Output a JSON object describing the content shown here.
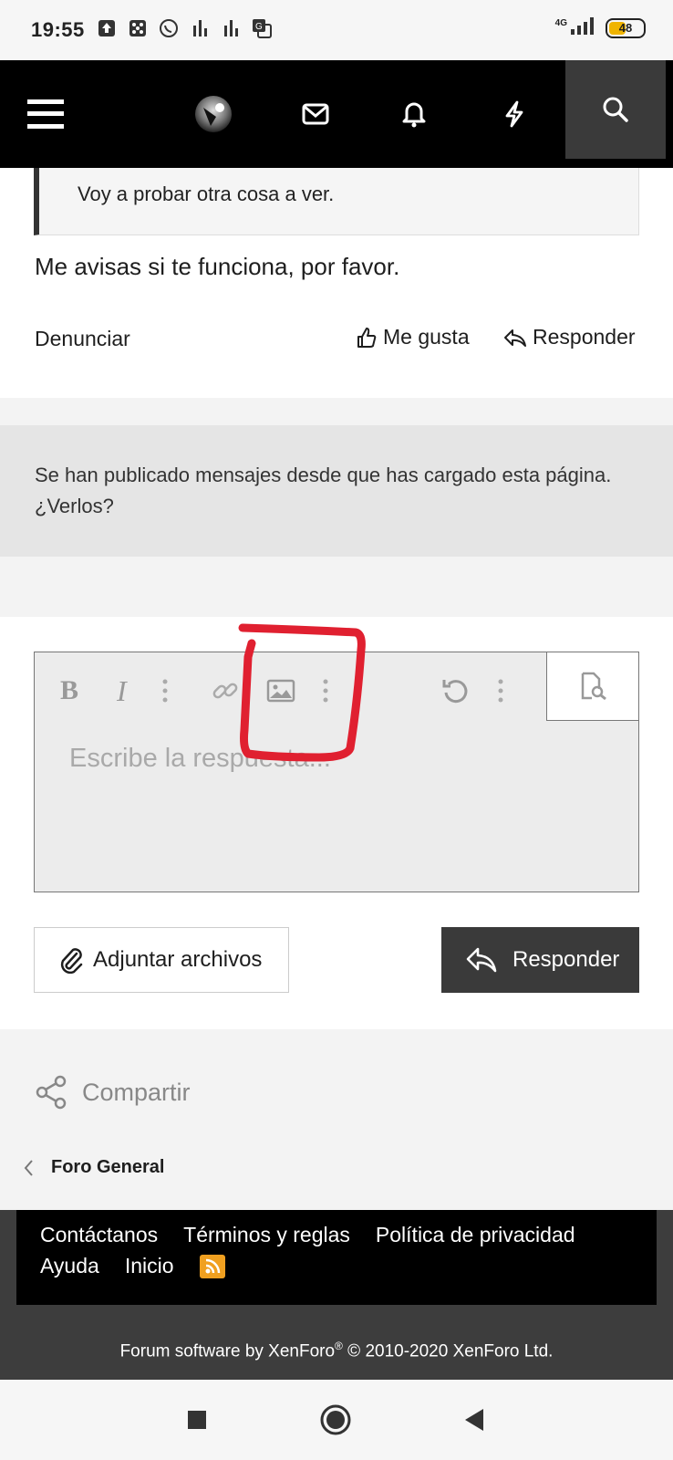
{
  "status_bar": {
    "time": "19:55",
    "network": "4G",
    "battery": "48"
  },
  "app_bar": {
    "icons": [
      "menu-icon",
      "avatar",
      "mail-icon",
      "bell-icon",
      "bolt-icon",
      "search-icon"
    ]
  },
  "post": {
    "quote_text": "Voy a probar otra cosa a ver.",
    "body_text": "Me avisas si te funciona, por favor.",
    "report_label": "Denunciar",
    "like_label": "Me gusta",
    "reply_label": "Responder"
  },
  "notice": {
    "text": "Se han publicado mensajes desde que has cargado esta página. ¿Verlos?"
  },
  "editor": {
    "bold_label": "B",
    "italic_label": "I",
    "placeholder": "Escribe la respuesta..."
  },
  "buttons": {
    "attach_label": "Adjuntar archivos",
    "submit_label": "Responder"
  },
  "share": {
    "label": "Compartir"
  },
  "breadcrumb": {
    "label": "Foro General"
  },
  "footer": {
    "links_row1": [
      "Contáctanos",
      "Términos y reglas",
      "Política de privacidad"
    ],
    "links_row2": [
      "Ayuda",
      "Inicio"
    ],
    "copyright_prefix": "Forum software by XenForo",
    "registered": "®",
    "copyright_suffix": " © 2010-2020 XenForo Ltd."
  },
  "colors": {
    "app_bar": "#000000",
    "search_button": "#3a3a3a",
    "submit_button": "#3a3a3a",
    "annotation": "#e02030",
    "rss": "#f0a020"
  }
}
